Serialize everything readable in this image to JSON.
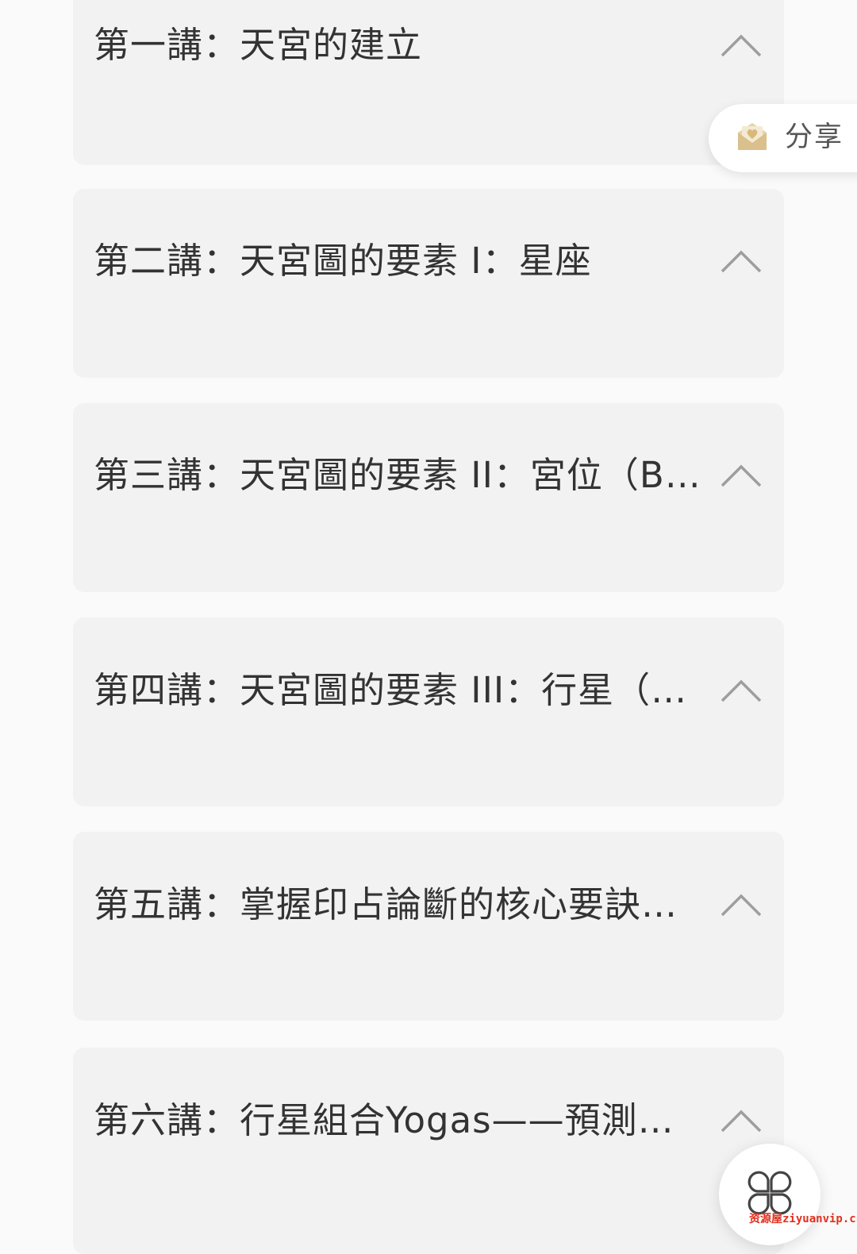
{
  "lessons": [
    {
      "title": "第一講：天宮的建立"
    },
    {
      "title": "第二講：天宮圖的要素 I：星座"
    },
    {
      "title": "第三講：天宮圖的要素 II：宮位（Bh..."
    },
    {
      "title": "第四講：天宮圖的要素 III：行星（Gr..."
    },
    {
      "title": "第五講：掌握印占論斷的核心要訣：..."
    },
    {
      "title": "第六講：行星組合Yogas——預測的重..."
    }
  ],
  "share": {
    "label": "分享",
    "icon": "share-envelope-icon",
    "icon_color": "#d9c08c"
  },
  "fab": {
    "icon": "grid-menu-icon"
  },
  "watermark": {
    "text": "资源屋ziyuanvip.cn"
  },
  "colors": {
    "background": "#fafafa",
    "card": "#f2f2f2",
    "text": "#333333",
    "chevron": "#9e9e9e",
    "watermark": "#e0301e"
  }
}
